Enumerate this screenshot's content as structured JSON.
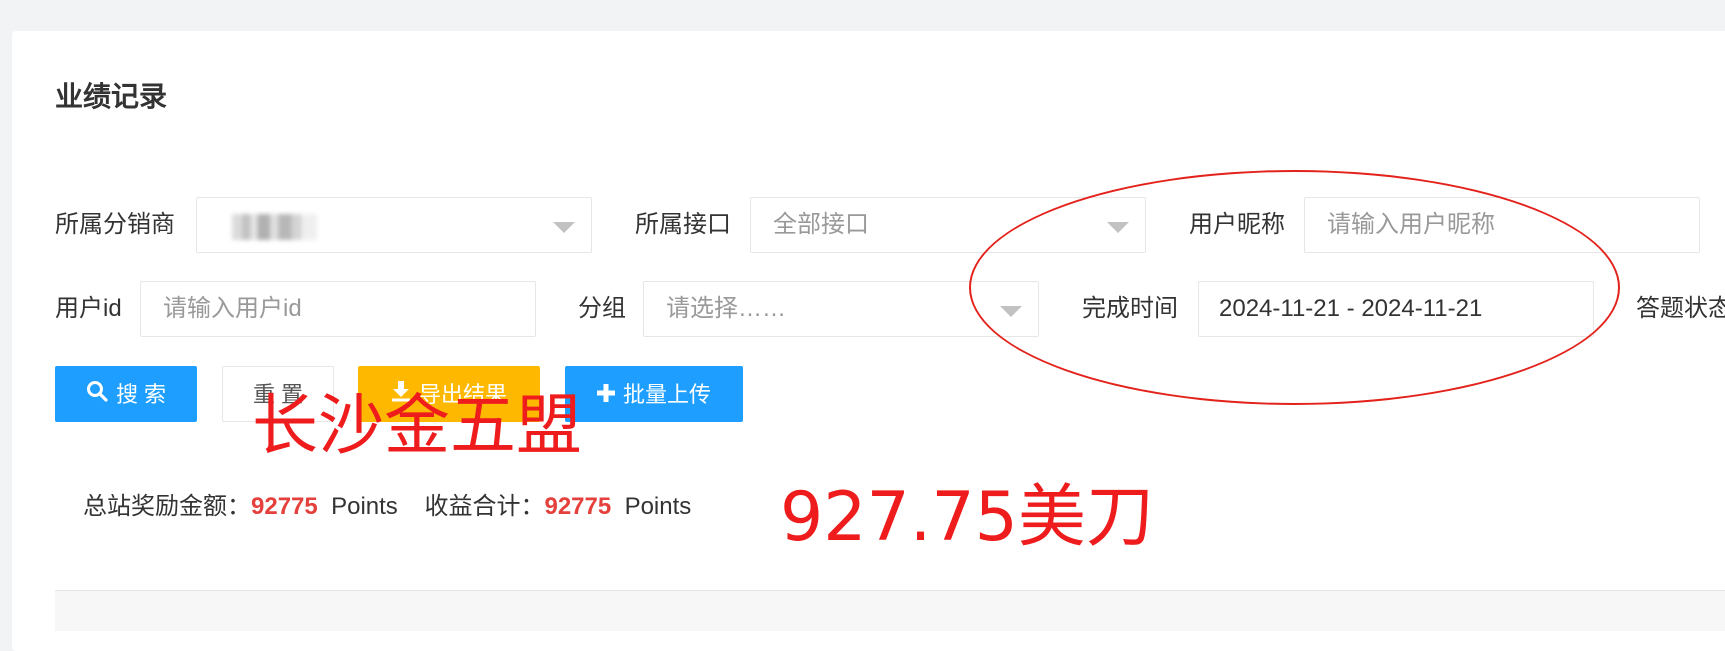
{
  "page": {
    "title": "业绩记录"
  },
  "filters": {
    "distributor": {
      "label": "所属分销商",
      "value": ""
    },
    "interface": {
      "label": "所属接口",
      "value": "全部接口"
    },
    "nickname": {
      "label": "用户昵称",
      "placeholder": "请输入用户昵称"
    },
    "user_id": {
      "label": "用户id",
      "placeholder": "请输入用户id"
    },
    "group": {
      "label": "分组",
      "placeholder": "请选择……"
    },
    "finish_time": {
      "label": "完成时间",
      "value": "2024-11-21 - 2024-11-21"
    },
    "answer_status": {
      "label": "答题状态"
    }
  },
  "buttons": {
    "search": "搜 索",
    "reset": "重 置",
    "export": "导出结果",
    "batch_upload": "批量上传"
  },
  "summary": {
    "reward_label": "总站奖励金额：",
    "reward_value": "92775",
    "reward_unit": "Points",
    "income_label": "收益合计：",
    "income_value": "92775",
    "income_unit": "Points"
  },
  "annotations": {
    "text1": "长沙金五盟",
    "text2": "927.75美刀",
    "color": "#ee1c1c"
  },
  "colors": {
    "primary": "#1e9fff",
    "warning": "#ffb800",
    "number_red": "#e5413c"
  }
}
